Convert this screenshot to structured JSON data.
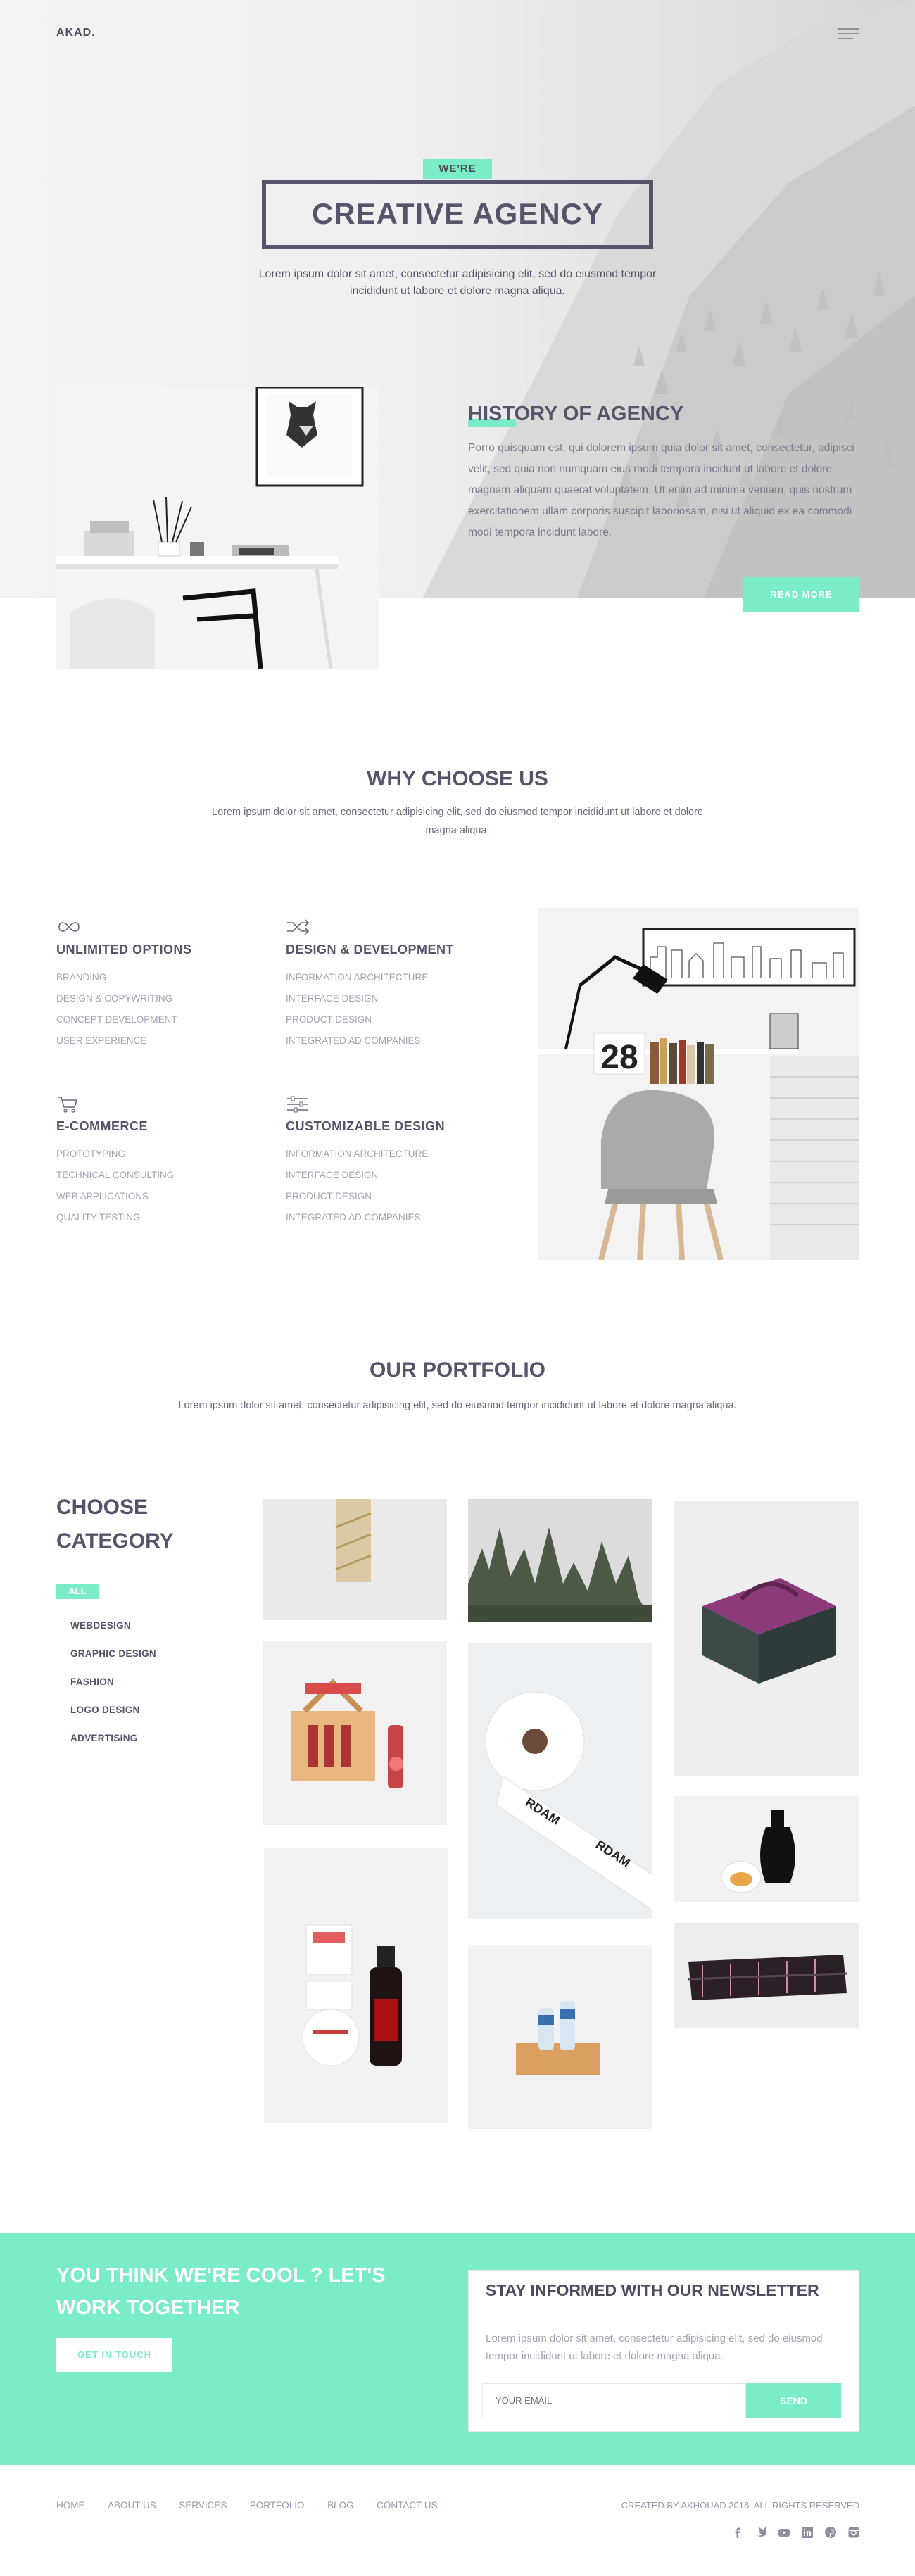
{
  "header": {
    "logo": "AKAD.",
    "menu_icon": "hamburger-menu-icon"
  },
  "hero": {
    "kicker": "WE'RE",
    "title": "CREATIVE AGENCY",
    "subtitle": "Lorem ipsum dolor sit amet, consectetur adipisicing elit, sed do eiusmod tempor incididunt ut labore et dolore magna aliqua."
  },
  "history": {
    "title": "HISTORY OF AGENCY",
    "text": "Porro quisquam est, qui dolorem ipsum quia dolor sit amet, consectetur, adipisci velit, sed quia non numquam eius modi tempora incidunt ut labore et dolore magnam aliquam quaerat voluptatem. Ut enim ad minima veniam, quis nostrum exercitationem ullam corporis suscipit laboriosam, nisi ut aliquid ex ea commodi modi tempora incidunt labore.",
    "button": "READ MORE"
  },
  "why": {
    "title_highlight": "WHY",
    "title_rest": " CHOOSE US",
    "subtitle": "Lorem ipsum dolor sit amet, consectetur adipisicing elit, sed do eiusmod tempor incididunt ut labore et dolore magna aliqua.",
    "services": [
      {
        "icon": "infinity-icon",
        "title": "UNLIMITED OPTIONS",
        "items": [
          "BRANDING",
          "DESIGN & COPYWRITING",
          "CONCEPT DEVELOPMENT",
          "USER EXPERIENCE"
        ]
      },
      {
        "icon": "shuffle-icon",
        "title": "DESIGN & DEVELOPMENT",
        "items": [
          "INFORMATION ARCHITECTURE",
          "INTERFACE DESIGN",
          "PRODUCT DESIGN",
          "INTEGRATED AD COMPANIES"
        ]
      },
      {
        "icon": "cart-icon",
        "title": "E-COMMERCE",
        "items": [
          "PROTOTYPING",
          "TECHNICAL CONSULTING",
          "WEB APPLICATIONS",
          "QUALITY TESTING"
        ]
      },
      {
        "icon": "sliders-icon",
        "title": "CUSTOMIZABLE DESIGN",
        "items": [
          "INFORMATION ARCHITECTURE",
          "INTERFACE DESIGN",
          "PRODUCT DESIGN",
          "INTEGRATED AD COMPANIES"
        ]
      }
    ],
    "photo_number": "28"
  },
  "portfolio": {
    "title_highlight": "OUR",
    "title_rest": " PORTFOLIO",
    "subtitle": "Lorem ipsum dolor sit amet, consectetur adipisicing elit, sed do eiusmod tempor incididunt ut labore et dolore magna aliqua.",
    "choose_line1": "CHOOSE",
    "choose_line2": "CATEGORY",
    "active_category": "ALL",
    "categories": [
      "WEBDESIGN",
      "GRAPHIC DESIGN",
      "FASHION",
      "LOGO DESIGN",
      "ADVERTISING"
    ],
    "roll_label": "RDAM"
  },
  "cta": {
    "title": "YOU THINK WE'RE COOL ? LET'S WORK TOGETHER",
    "button": "GET IN TOUCH"
  },
  "newsletter": {
    "title": "STAY INFORMED WITH OUR NEWSLETTER",
    "text": "Lorem ipsum dolor sit amet, consectetur adipisicing elit, sed do eiusmod tempor incididunt ut labore et dolore magna aliqua.",
    "email_placeholder": "YOUR EMAIL",
    "send": "SEND"
  },
  "footer": {
    "nav": [
      "HOME",
      "ABOUT US",
      "SERVICES",
      "PORTFOLIO",
      "BLOG",
      "CONTACT US"
    ],
    "separator": "-",
    "copyright": "CREATED BY AKHOUAD 2016. ALL RIGHTS RESERVED",
    "social": [
      "facebook-icon",
      "twitter-icon",
      "youtube-icon",
      "linkedin-icon",
      "pinterest-icon",
      "instagram-icon"
    ]
  },
  "colors": {
    "accent": "#7aecc7",
    "text": "#55546a",
    "muted": "#a4a3b2"
  }
}
